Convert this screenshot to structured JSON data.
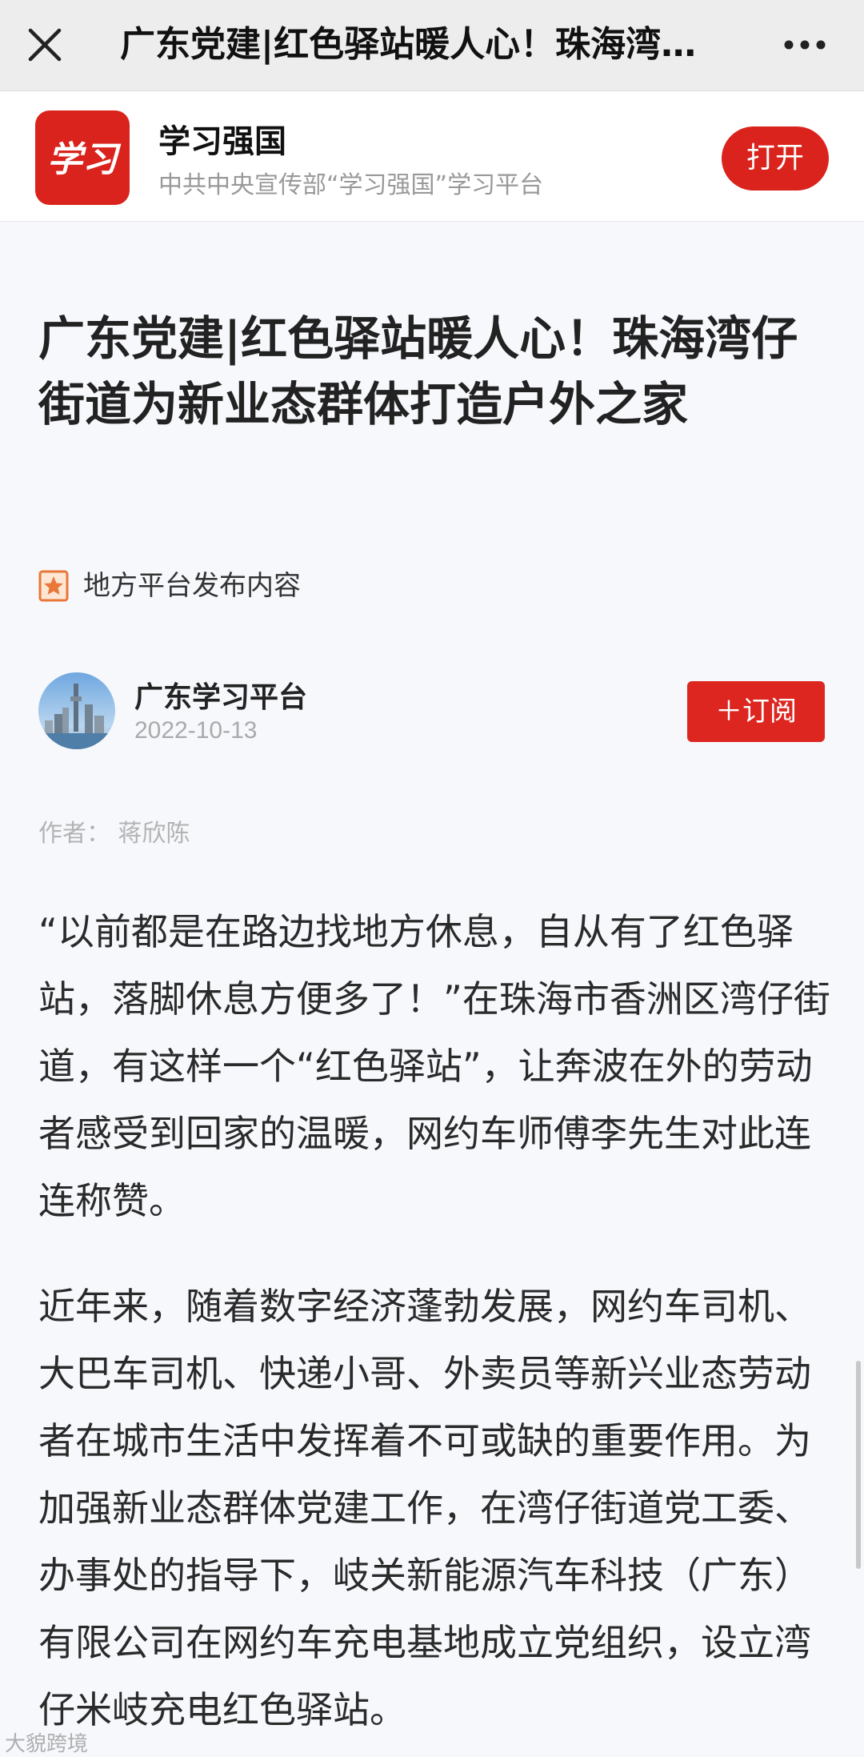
{
  "topbar": {
    "title": "广东党建|红色驿站暖人心！珠海湾…",
    "close_icon": "close-icon",
    "more_icon": "more-horizontal-icon"
  },
  "app_banner": {
    "logo_text": "学习",
    "name": "学习强国",
    "subtitle": "中共中央宣传部“学习强国”学习平台",
    "open_label": "打开",
    "accent_color": "#d9231c"
  },
  "article": {
    "title": "广东党建|红色驿站暖人心！珠海湾仔街道为新业态群体打造户外之家",
    "source_label": "地方平台发布内容",
    "source_icon": "star-badge-icon",
    "author": {
      "name": "广东学习平台",
      "date": "2022-10-13",
      "subscribe_label": "＋订阅"
    },
    "byline": "作者：  蒋欣陈",
    "paragraphs": [
      "“以前都是在路边找地方休息，自从有了红色驿站，落脚休息方便多了！”在珠海市香洲区湾仔街道，有这样一个“红色驿站”，让奔波在外的劳动者感受到回家的温暖，网约车师傅李先生对此连连称赞。",
      "近年来，随着数字经济蓬勃发展，网约车司机、大巴车司机、快递小哥、外卖员等新兴业态劳动者在城市生活中发挥着不可或缺的重要作用。为加强新业态群体党建工作，在湾仔街道党工委、办事处的指导下，岐关新能源汽车科技（广东）有限公司在网约车充电基地成立党组织，设立湾仔米岐充电红色驿站。"
    ]
  },
  "watermark": "大貌跨境"
}
